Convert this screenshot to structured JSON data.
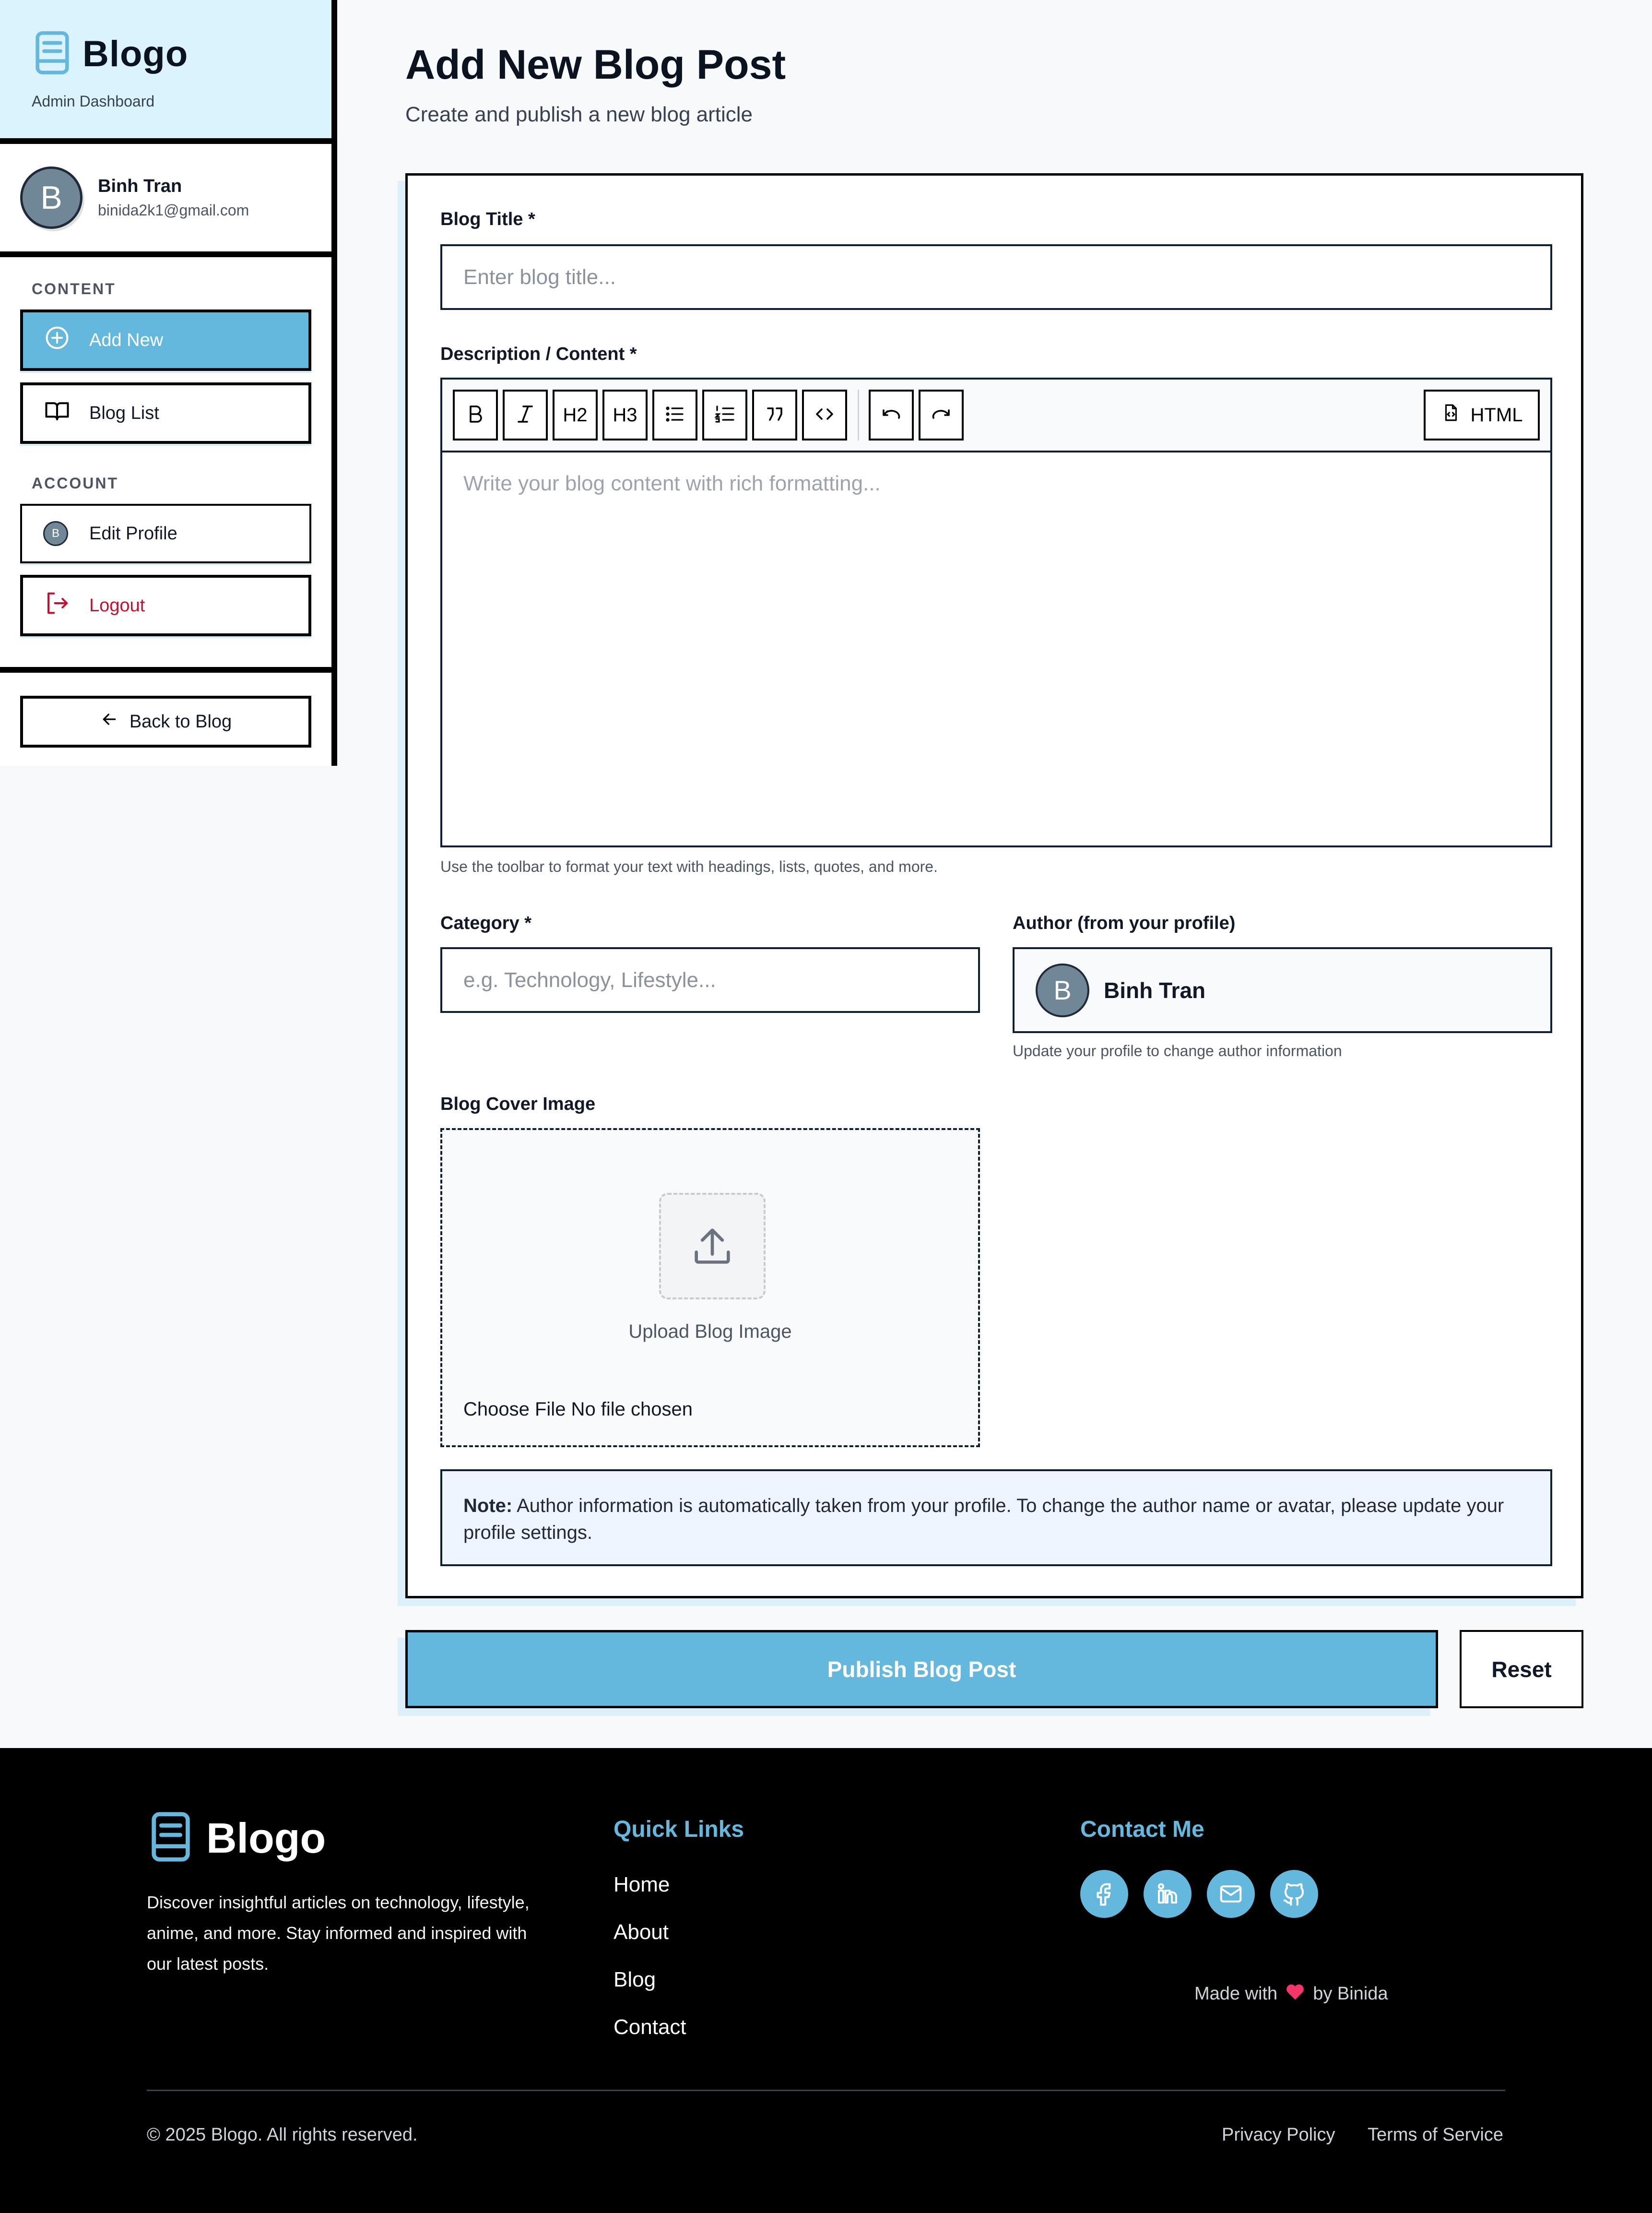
{
  "brand": {
    "name": "Blogo",
    "subtitle": "Admin Dashboard"
  },
  "user": {
    "name": "Binh Tran",
    "email": "binida2k1@gmail.com",
    "initial": "B"
  },
  "sidebar": {
    "content_label": "CONTENT",
    "account_label": "ACCOUNT",
    "items": [
      {
        "label": "Add New",
        "icon": "plus-circle-icon"
      },
      {
        "label": "Blog List",
        "icon": "book-open-icon"
      },
      {
        "label": "Edit Profile",
        "icon": "avatar"
      },
      {
        "label": "Logout",
        "icon": "logout-icon"
      }
    ],
    "back_label": "Back to Blog"
  },
  "page": {
    "title": "Add New Blog Post",
    "subtitle": "Create and publish a new blog article"
  },
  "form": {
    "title_label": "Blog Title *",
    "title_placeholder": "Enter blog title...",
    "content_label": "Description / Content *",
    "content_placeholder": "Write your blog content with rich formatting...",
    "toolbar": {
      "bold": "bold-icon",
      "italic": "italic-icon",
      "h2": "H2",
      "h3": "H3",
      "bullet": "bullet-list-icon",
      "ordered": "ordered-list-icon",
      "quote": "quote-icon",
      "code": "code-icon",
      "undo": "undo-icon",
      "redo": "redo-icon",
      "html_label": "HTML"
    },
    "content_hint": "Use the toolbar to format your text with headings, lists, quotes, and more.",
    "category_label": "Category *",
    "category_placeholder": "e.g. Technology, Lifestyle...",
    "author_label": "Author (from your profile)",
    "author_name": "Binh Tran",
    "author_hint": "Update your profile to change author information",
    "cover_label": "Blog Cover Image",
    "upload_text": "Upload Blog Image",
    "file_text": "Choose File No file chosen",
    "note_bold": "Note:",
    "note_text": "Author information is automatically taken from your profile. To change the author name or avatar, please update your profile settings."
  },
  "actions": {
    "publish": "Publish Blog Post",
    "reset": "Reset"
  },
  "footer": {
    "brand": "Blogo",
    "description": "Discover insightful articles on technology, lifestyle, anime, and more. Stay informed and inspired with our latest posts.",
    "quick_links_title": "Quick Links",
    "links": [
      "Home",
      "About",
      "Blog",
      "Contact"
    ],
    "contact_title": "Contact Me",
    "socials": [
      "facebook-icon",
      "linkedin-icon",
      "mail-icon",
      "github-icon"
    ],
    "made_with": "Made with",
    "by": "by Binida",
    "copyright": "© 2025 Blogo. All rights reserved.",
    "privacy": "Privacy Policy",
    "terms": "Terms of Service"
  },
  "colors": {
    "accent": "#64b8de",
    "brand_bg": "#dbf3fd",
    "danger": "#c8102e",
    "note_bg": "#eef5fe",
    "footer_bg": "#000000"
  }
}
